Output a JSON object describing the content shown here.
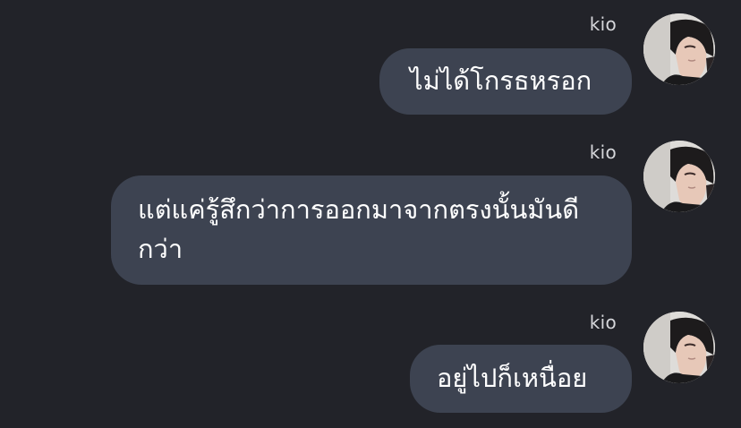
{
  "theme": {
    "background": "#222329",
    "bubble_color": "#3d4351",
    "text_color": "#ffffff",
    "sender_color": "#d6d7db"
  },
  "messages": [
    {
      "sender": "kio",
      "avatar_icon": "user-avatar-photo",
      "lines": [
        "ไม่ได้โกรธหรอก"
      ]
    },
    {
      "sender": "kio",
      "avatar_icon": "user-avatar-photo",
      "lines": [
        "แต่แค่รู้สึกว่าการออกมาจากตรงนั้นมันดี",
        "กว่า"
      ]
    },
    {
      "sender": "kio",
      "avatar_icon": "user-avatar-photo",
      "lines": [
        "อยู่ไปก็เหนื่อย"
      ]
    }
  ]
}
